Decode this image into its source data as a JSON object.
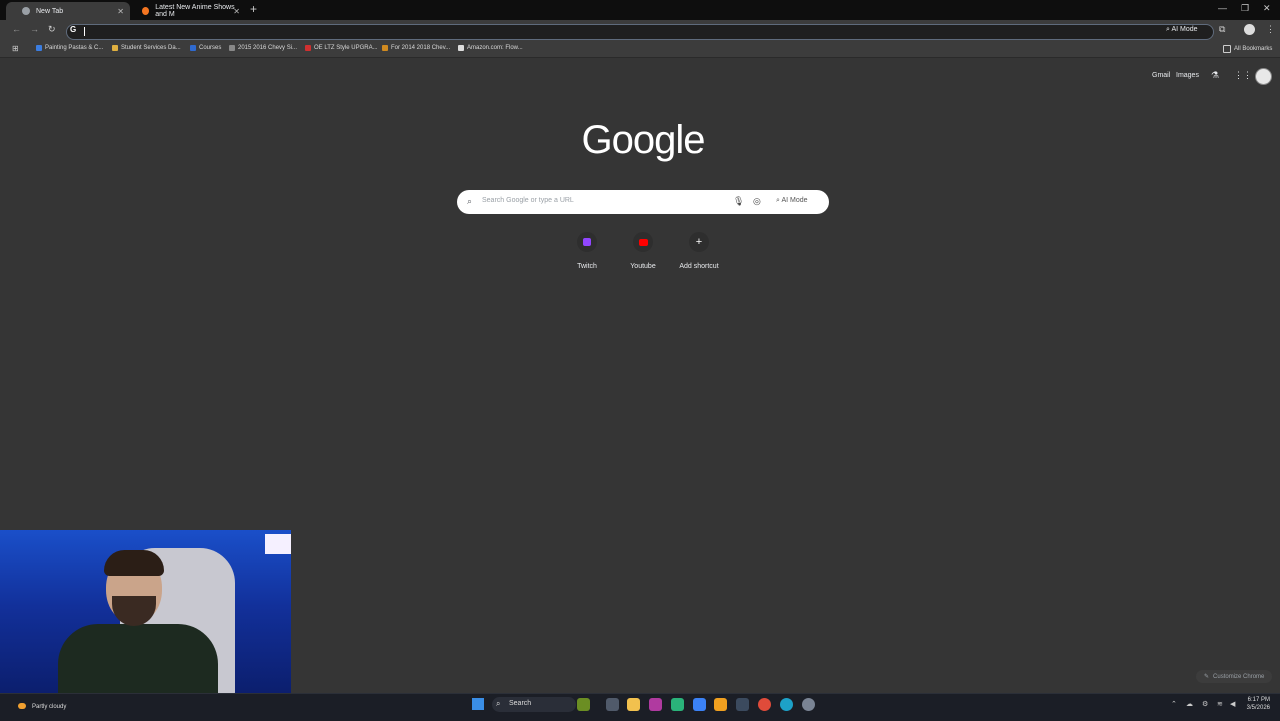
{
  "tabs": [
    {
      "title": "New Tab",
      "icon": "chrome-icon"
    },
    {
      "title": "Latest New Anime Shows and M",
      "icon": "crunchyroll-icon"
    }
  ],
  "omnibox": {
    "ai_mode": "AI Mode"
  },
  "bookmarks": [
    {
      "label": "Painting Pastas & C..."
    },
    {
      "label": "Student Services Da..."
    },
    {
      "label": "Courses"
    },
    {
      "label": "2015 2016 Chevy Si..."
    },
    {
      "label": "OE LTZ Style UPGRA..."
    },
    {
      "label": "For 2014 2018 Chev..."
    },
    {
      "label": "Amazon.com: Flow..."
    }
  ],
  "all_bookmarks": "All Bookmarks",
  "header": {
    "gmail": "Gmail",
    "images": "Images"
  },
  "logo": "Google",
  "search": {
    "placeholder": "Search Google or type a URL",
    "ai_mode": "AI Mode"
  },
  "shortcuts": [
    {
      "label": "Twitch",
      "color": "#9146ff"
    },
    {
      "label": "Youtube",
      "color": "#ff0000"
    },
    {
      "label": "Add shortcut",
      "icon": "plus-icon"
    }
  ],
  "customize": "Customize Chrome",
  "taskbar": {
    "search_label": "Search",
    "weather": "Partly cloudy",
    "time": "6:17 PM",
    "date": "3/5/2026"
  }
}
